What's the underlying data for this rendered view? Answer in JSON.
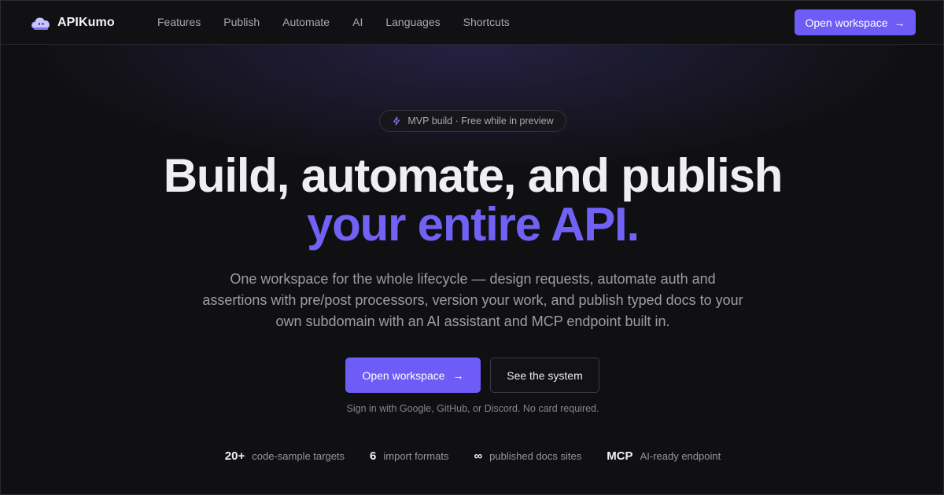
{
  "nav": {
    "brand": "APIKumo",
    "links": [
      "Features",
      "Publish",
      "Automate",
      "AI",
      "Languages",
      "Shortcuts"
    ],
    "cta": "Open workspace"
  },
  "badge": {
    "icon": "lightning-icon",
    "text": "MVP build · Free while in preview"
  },
  "hero": {
    "line1": "Build, automate, and publish",
    "line2": "your entire API.",
    "subtitle": "One workspace for the whole lifecycle — design requests, automate auth and assertions with pre/post processors, version your work, and publish typed docs to your own subdomain with an AI assistant and MCP endpoint built in.",
    "primary_cta": "Open workspace",
    "secondary_cta": "See the system",
    "signin_note": "Sign in with Google, GitHub, or Discord. No card required."
  },
  "stats": [
    {
      "value": "20+",
      "label": "code-sample targets"
    },
    {
      "value": "6",
      "label": "import formats"
    },
    {
      "value": "∞",
      "label": "published docs sites"
    },
    {
      "value": "MCP",
      "label": "AI-ready endpoint"
    }
  ],
  "colors": {
    "accent": "#6e5cf6",
    "headline_accent": "#7261f5",
    "background": "#101013"
  }
}
